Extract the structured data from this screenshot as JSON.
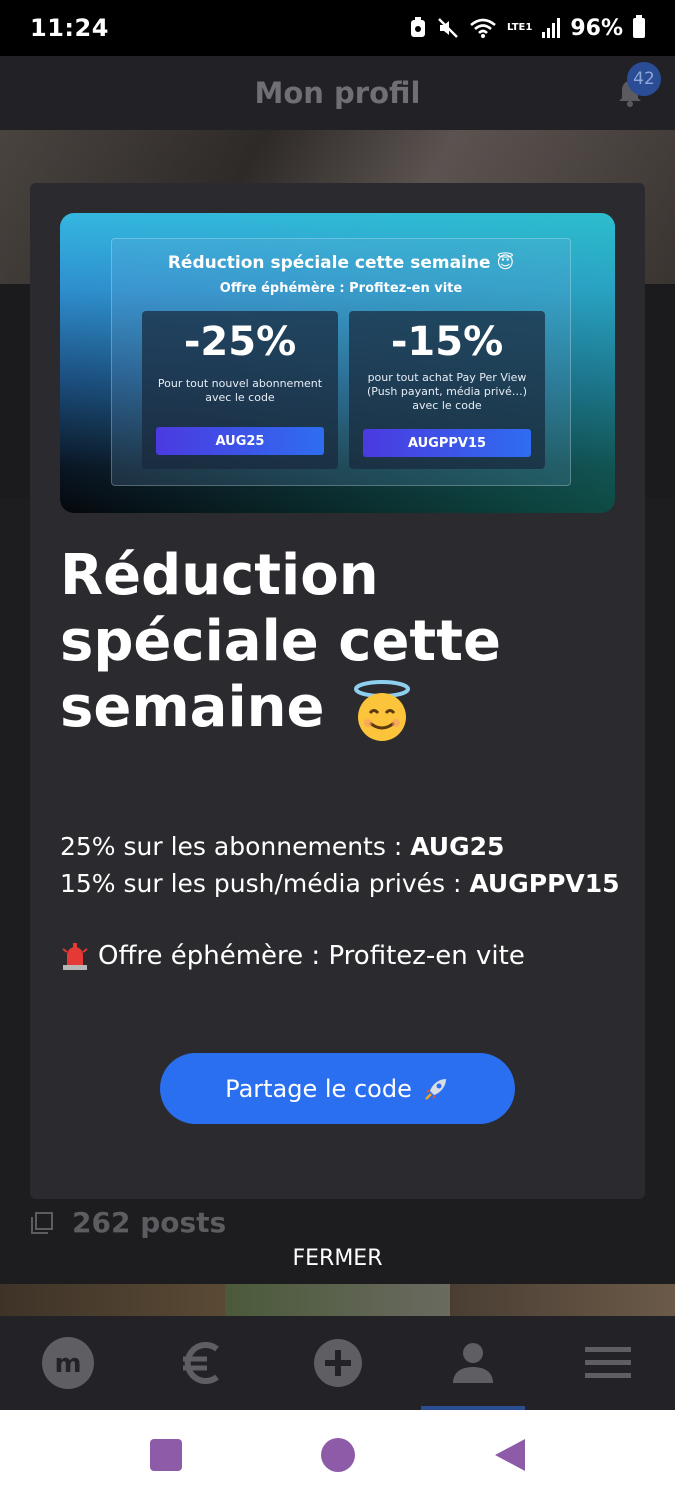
{
  "status_bar": {
    "time": "11:24",
    "battery": "96%",
    "lte_label": "LTE1"
  },
  "header": {
    "title": "Mon profil",
    "notification_count": "42"
  },
  "banner": {
    "title": "Réduction spéciale cette semaine 😇",
    "subtitle": "Offre éphémère : Profitez-en vite",
    "offers": [
      {
        "percent": "-25%",
        "description": "Pour tout nouvel abonnement avec le code",
        "code": "AUG25"
      },
      {
        "percent": "-15%",
        "description": "pour tout achat Pay Per View (Push payant, média privé…) avec le code",
        "code": "AUGPPV15"
      }
    ]
  },
  "modal": {
    "heading": "Réduction spéciale cette semaine",
    "line1_text": "25% sur les abonnements : ",
    "line1_code": "AUG25",
    "line2_text": "15% sur les push/média privés : ",
    "line2_code": "AUGPPV15",
    "alert_text": "Offre éphémère : Profitez-en vite",
    "share_label": "Partage le code"
  },
  "profile": {
    "posts_count": "262 posts"
  },
  "close_label": "FERMER",
  "colors": {
    "accent": "#2a6ff0",
    "modal_bg": "#2b2b2f",
    "tab_active": "#2b4d92"
  },
  "tabs": [
    {
      "name": "home",
      "icon": "m-logo-icon"
    },
    {
      "name": "earnings",
      "icon": "euro-icon"
    },
    {
      "name": "create",
      "icon": "plus-circle-icon"
    },
    {
      "name": "profile",
      "icon": "person-icon",
      "active": true
    },
    {
      "name": "menu",
      "icon": "hamburger-menu-icon"
    }
  ]
}
